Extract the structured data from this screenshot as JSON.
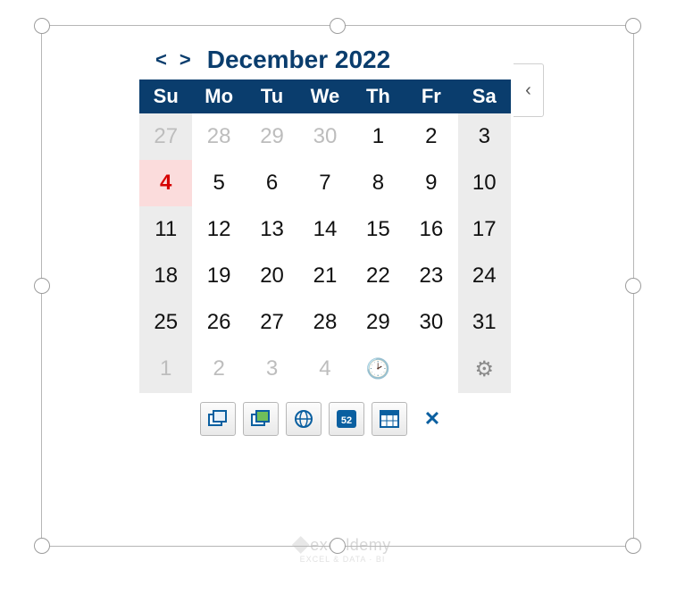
{
  "watermark": {
    "text": "exceldemy",
    "sub": "EXCEL & DATA · BI"
  },
  "header": {
    "title": "December 2022",
    "prev": "<",
    "next": ">"
  },
  "dow": [
    "Su",
    "Mo",
    "Tu",
    "We",
    "Th",
    "Fr",
    "Sa"
  ],
  "weeks": [
    [
      {
        "n": "27",
        "cls": "weekend outside"
      },
      {
        "n": "28",
        "cls": "outside"
      },
      {
        "n": "29",
        "cls": "outside"
      },
      {
        "n": "30",
        "cls": "outside"
      },
      {
        "n": "1",
        "cls": ""
      },
      {
        "n": "2",
        "cls": ""
      },
      {
        "n": "3",
        "cls": "weekend"
      }
    ],
    [
      {
        "n": "4",
        "cls": "weekend today"
      },
      {
        "n": "5",
        "cls": ""
      },
      {
        "n": "6",
        "cls": ""
      },
      {
        "n": "7",
        "cls": ""
      },
      {
        "n": "8",
        "cls": ""
      },
      {
        "n": "9",
        "cls": ""
      },
      {
        "n": "10",
        "cls": "weekend"
      }
    ],
    [
      {
        "n": "11",
        "cls": "weekend"
      },
      {
        "n": "12",
        "cls": ""
      },
      {
        "n": "13",
        "cls": ""
      },
      {
        "n": "14",
        "cls": ""
      },
      {
        "n": "15",
        "cls": ""
      },
      {
        "n": "16",
        "cls": ""
      },
      {
        "n": "17",
        "cls": "weekend"
      }
    ],
    [
      {
        "n": "18",
        "cls": "weekend"
      },
      {
        "n": "19",
        "cls": ""
      },
      {
        "n": "20",
        "cls": ""
      },
      {
        "n": "21",
        "cls": ""
      },
      {
        "n": "22",
        "cls": ""
      },
      {
        "n": "23",
        "cls": ""
      },
      {
        "n": "24",
        "cls": "weekend"
      }
    ],
    [
      {
        "n": "25",
        "cls": "weekend"
      },
      {
        "n": "26",
        "cls": ""
      },
      {
        "n": "27",
        "cls": ""
      },
      {
        "n": "28",
        "cls": ""
      },
      {
        "n": "29",
        "cls": ""
      },
      {
        "n": "30",
        "cls": ""
      },
      {
        "n": "31",
        "cls": "weekend"
      }
    ],
    [
      {
        "n": "1",
        "cls": "weekend outside"
      },
      {
        "n": "2",
        "cls": "outside"
      },
      {
        "n": "3",
        "cls": "outside"
      },
      {
        "n": "4",
        "cls": "outside"
      },
      {
        "n": "",
        "cls": "icon-cell",
        "icon": "clock"
      },
      {
        "n": "",
        "cls": ""
      },
      {
        "n": "",
        "cls": "weekend icon-cell",
        "icon": "gear"
      }
    ]
  ],
  "toolbar": [
    {
      "name": "restore-window-icon"
    },
    {
      "name": "cascade-window-icon"
    },
    {
      "name": "globe-icon"
    },
    {
      "name": "week-number-icon",
      "text": "52"
    },
    {
      "name": "grid-view-icon"
    },
    {
      "name": "close-icon",
      "text": "✕",
      "close": true
    }
  ],
  "collapse": "‹"
}
